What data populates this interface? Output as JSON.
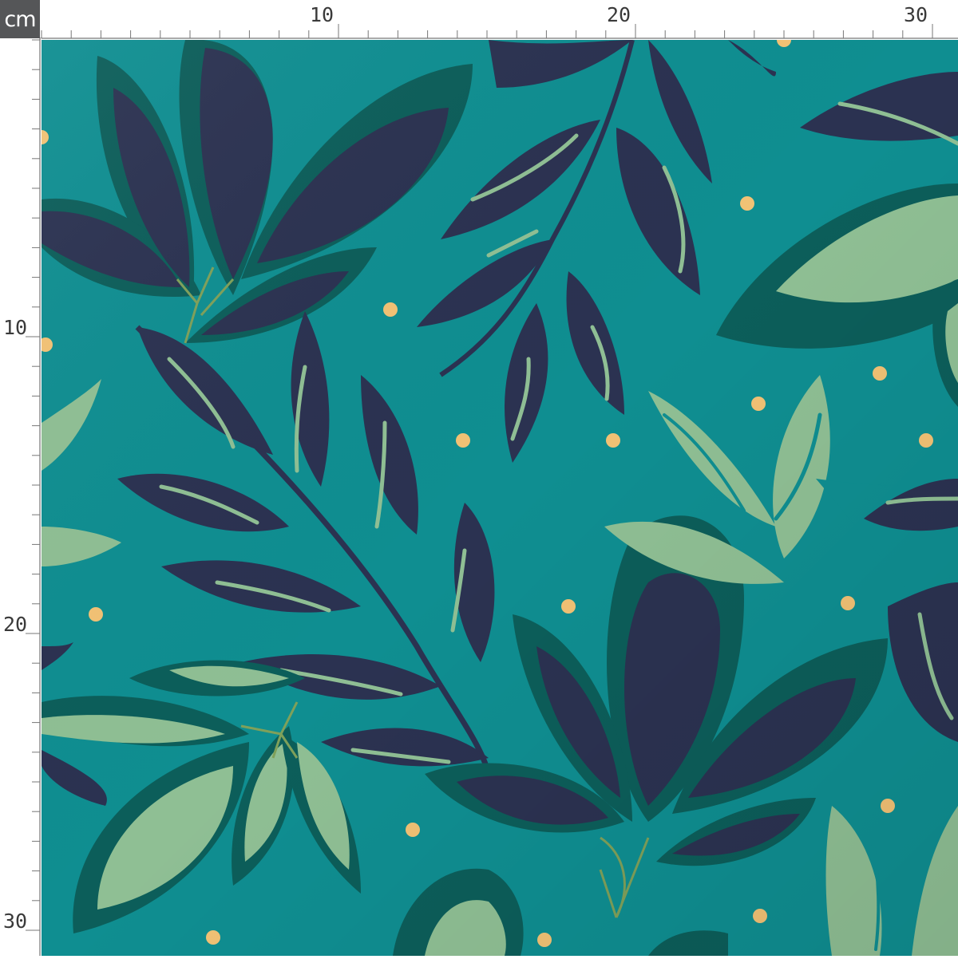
{
  "ruler": {
    "unit": "cm",
    "top_labels": [
      "10",
      "20",
      "30"
    ],
    "left_labels": [
      "10",
      "20",
      "30"
    ]
  },
  "fabric": {
    "pattern": "botanical leaves with dots",
    "colors": {
      "base": "#0f8e91",
      "navy_leaf": "#2b3251",
      "dark_teal_leaf": "#0c5e5a",
      "sage_leaf": "#8fbf94",
      "dot": "#f2c275",
      "stem": "#7fa05a"
    }
  }
}
